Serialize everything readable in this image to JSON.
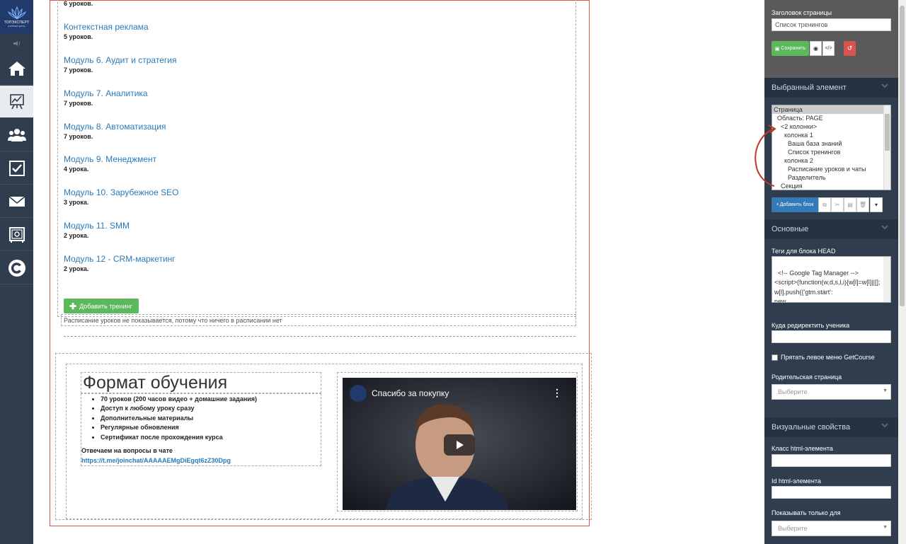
{
  "app": {
    "brand": "ТОПЭКСПЕРТ",
    "brand_sub": "учебный центр"
  },
  "nav": {
    "items": [
      {
        "icon": "home-icon"
      },
      {
        "icon": "chart-icon",
        "active": true
      },
      {
        "icon": "users-icon"
      },
      {
        "icon": "tasks-checkbox-icon"
      },
      {
        "icon": "mail-icon"
      },
      {
        "icon": "safe-icon"
      },
      {
        "icon": "getcourse-icon"
      }
    ]
  },
  "page": {
    "top_count": "6 уроков.",
    "courses": [
      {
        "title": "Контекстная реклама",
        "count": "5 уроков."
      },
      {
        "title": "Модуль 6. Аудит и стратегия",
        "count": "7 уроков."
      },
      {
        "title": "Модуль 7. Аналитика",
        "count": "7 уроков."
      },
      {
        "title": "Модуль 8. Автоматизация",
        "count": "7 уроков."
      },
      {
        "title": "Модуль 9. Менеджмент",
        "count": "4 урока."
      },
      {
        "title": "Модуль 10. Зарубежное SEO",
        "count": "3 урока."
      },
      {
        "title": "Модуль 11. SMM",
        "count": "2 урока."
      },
      {
        "title": "Модуль 12 - CRM-маркетинг",
        "count": "2 урока."
      }
    ],
    "add_training_label": "Добавить тренинг",
    "schedule_note": "Расписание уроков не показывается, потому что ничего в расписании нет",
    "format": {
      "title": "Формат обучения",
      "bullets": [
        "70 уроков (200 часов видео + домашние задания)",
        "Доступ к любому уроку сразу",
        "Дополнительные материалы",
        "Регулярные обновления",
        "Сертификат после прохождения курса"
      ],
      "answer_text": "Отвечаем на вопросы в чате",
      "link": "https://t.me/joinchat/AAAAAEMgDiEgqt6zZ30Dpg"
    },
    "video": {
      "title": "Спасибо за покупку"
    }
  },
  "panel": {
    "page_title_label": "Заголовок страницы",
    "page_title_value": "Список тренингов",
    "save_label": "Сохранить",
    "selected_section": "Выбранный элемент",
    "tree": [
      {
        "label": "Страница",
        "indent": 0,
        "selected": true
      },
      {
        "label": "Область: PAGE",
        "indent": 1
      },
      {
        "label": "<2 колонки>",
        "indent": 2
      },
      {
        "label": "колонка 1",
        "indent": 3
      },
      {
        "label": "Ваша база знаний",
        "indent": 4
      },
      {
        "label": "Список тренингов",
        "indent": 4
      },
      {
        "label": "колонка 2",
        "indent": 3
      },
      {
        "label": "Расписание уроков и чаты",
        "indent": 4
      },
      {
        "label": "Разделитель",
        "indent": 4
      },
      {
        "label": "Секция",
        "indent": 2
      }
    ],
    "add_block_label": "Добавить блок",
    "basic_section": "Основные",
    "head_tags_label": "Теги для блока HEAD",
    "head_tags_value": "<!-- Google Tag Manager -->\n<script>(function(w,d,s,l,i){w[l]=w[l]||[];w[l].push({'gtm.start':\nnew\nDate().getTime(),event:'gtm.js'});var",
    "redirect_label": "Куда редиректить ученика",
    "redirect_value": "",
    "hide_menu_label": "Прятать левое меню GetCourse",
    "parent_page_label": "Родительская страница",
    "parent_page_placeholder": "Выберите",
    "visual_section": "Визуальные свойства",
    "class_label": "Класс html-элемента",
    "id_label": "Id html-элемента",
    "show_only_label": "Показывать только для",
    "show_only_placeholder": "Выберите"
  },
  "colors": {
    "nav_bg": "#2f3d4e",
    "link": "#2a7ab8",
    "success": "#5cb85c",
    "danger": "#d9534f",
    "primary": "#337ab7",
    "annotation": "#c0392b"
  }
}
